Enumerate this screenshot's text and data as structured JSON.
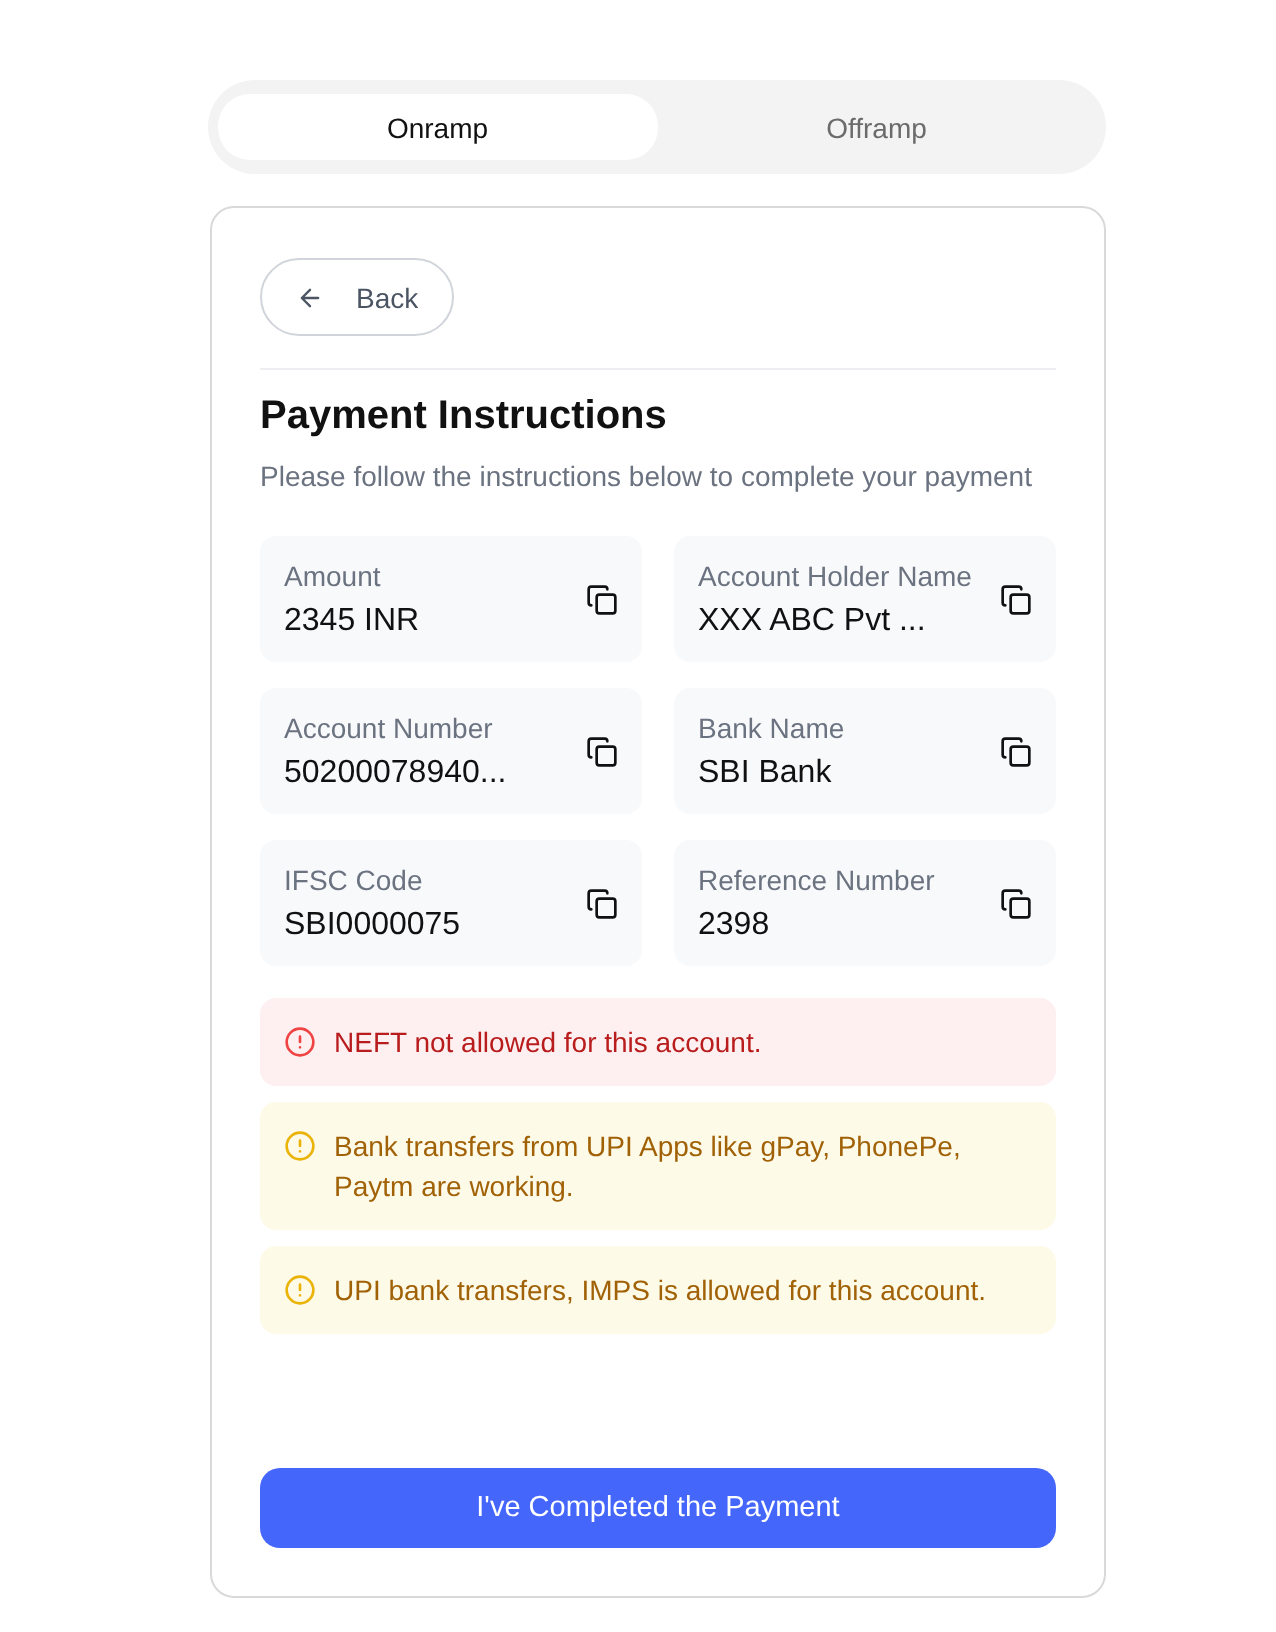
{
  "tabs": [
    {
      "label": "Onramp",
      "selected": true
    },
    {
      "label": "Offramp",
      "selected": false
    }
  ],
  "back_button": {
    "label": "Back"
  },
  "title": "Payment Instructions",
  "subtitle": "Please follow the instructions below to complete your payment",
  "fields": [
    {
      "label": "Amount",
      "value": "2345 INR"
    },
    {
      "label": "Account Holder Name",
      "value": "XXX ABC Pvt ..."
    },
    {
      "label": "Account Number",
      "value": "50200078940..."
    },
    {
      "label": "Bank Name",
      "value": "SBI Bank"
    },
    {
      "label": "IFSC Code",
      "value": "SBI0000075"
    },
    {
      "label": "Reference Number",
      "value": "2398"
    }
  ],
  "alerts": [
    {
      "kind": "error",
      "text": "NEFT not allowed for this account."
    },
    {
      "kind": "warning",
      "text": "Bank transfers from UPI Apps like gPay, PhonePe, Paytm are working."
    },
    {
      "kind": "warning",
      "text": "UPI bank transfers, IMPS is allowed for this account."
    }
  ],
  "submit_button": {
    "label": "I've Completed the Payment"
  }
}
